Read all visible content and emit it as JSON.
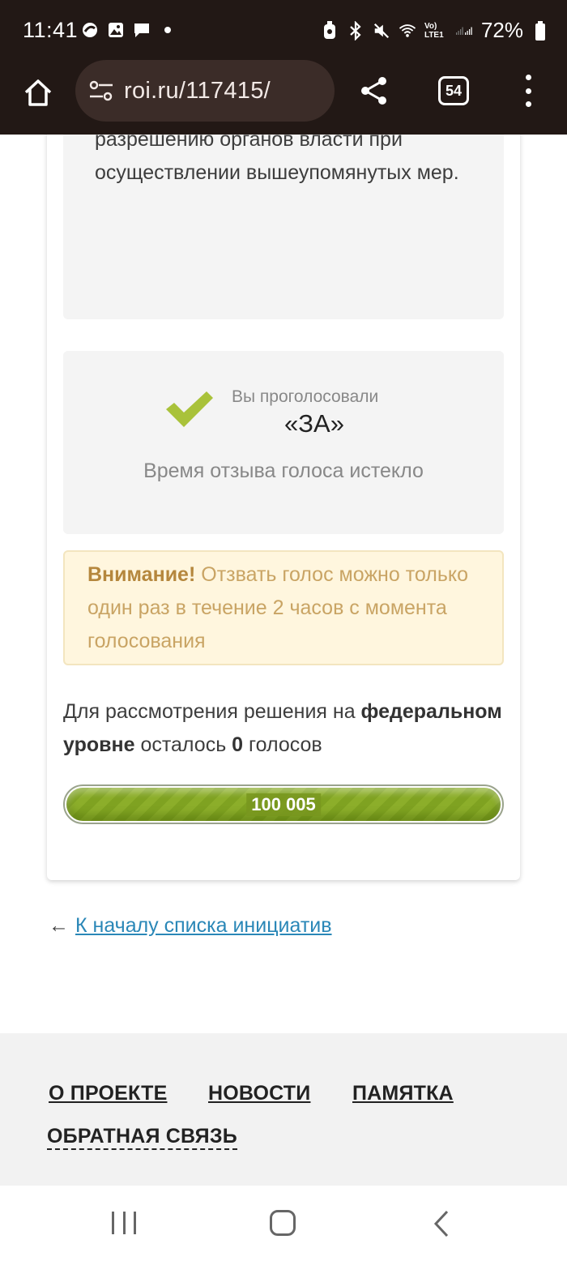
{
  "status_bar": {
    "time": "11:41",
    "battery": "72%",
    "icons": [
      "data-saver-icon",
      "gallery-icon",
      "chat-icon",
      "dot-icon",
      "alarm-icon",
      "bluetooth-icon",
      "mute-icon",
      "wifi-icon",
      "volte-icon",
      "signal-icon",
      "battery-icon"
    ],
    "volte_label": "Vo) LTE1"
  },
  "browser": {
    "url": "roi.ru/117415/",
    "tab_count": "54"
  },
  "initiative": {
    "text_tail": "разрешению органов власти при осуществлении вышеупомянутых мер."
  },
  "vote": {
    "voted_label": "Вы проголосовали",
    "voted_value": "«ЗА»",
    "revoke_status": "Время отзыва голоса истекло"
  },
  "warning": {
    "title": "Внимание!",
    "text": " Отзвать голос можно только один раз в течение 2 часов с момента голосования"
  },
  "remaining": {
    "text_start": "Для рассмотрения решения на ",
    "level": "федеральном уровне",
    "text_mid": " осталось ",
    "count": "0",
    "text_end": " голосов"
  },
  "progress": {
    "label": "100 005",
    "fill_fraction": 1.0
  },
  "back_link": {
    "arrow": "←",
    "label": "К началу списка инициатив"
  },
  "footer_nav": {
    "about": "О ПРОЕКТЕ",
    "news": "НОВОСТИ",
    "memo": "ПАМЯТКА",
    "feedback": "ОБРАТНАЯ СВЯЗЬ"
  },
  "colors": {
    "chrome_bg": "#221815",
    "accent_green": "#8cae2a",
    "link_blue": "#2a87b7",
    "warning_text": "#c9a464"
  }
}
